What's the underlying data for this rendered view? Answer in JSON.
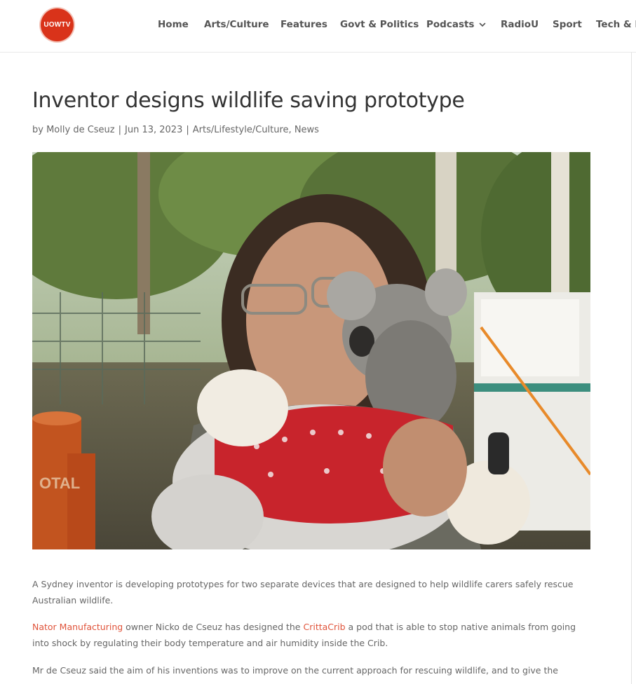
{
  "header": {
    "logo_text": "UOWTV",
    "nav": [
      {
        "label": "Home"
      },
      {
        "label": "Arts/Culture"
      },
      {
        "label": "Features"
      },
      {
        "label": "Govt & Politics"
      },
      {
        "label": "Podcasts",
        "has_dropdown": true
      },
      {
        "label": "RadioU"
      },
      {
        "label": "Sport"
      },
      {
        "label": "Tech & R"
      }
    ]
  },
  "article": {
    "title": "Inventor designs wildlife saving prototype",
    "meta": {
      "by": "by",
      "author": "Molly de Cseuz",
      "separator": "|",
      "date": "Jun 13, 2023",
      "category1": "Arts/Lifestyle/Culture",
      "comma": ",",
      "category2": "News"
    },
    "paragraph1": "A Sydney inventor is developing prototypes for two separate devices that are designed to help wildlife carers safely rescue Australian wildlife.",
    "paragraph2": {
      "link1": "Nator Manufacturing",
      "text1": " owner Nicko de Cseuz has designed the ",
      "link2": "CrittaCrib",
      "text2": " a pod that is able to stop native animals from going into shock by regulating their body temperature and air humidity inside the Crib."
    },
    "paragraph3": "Mr de Cseuz said the aim of his inventions was to improve on the current approach for rescuing wildlife, and to give the"
  },
  "colors": {
    "accent": "#e0533a",
    "logo_bg": "#d9331a",
    "title": "#333333",
    "body": "#666666"
  }
}
